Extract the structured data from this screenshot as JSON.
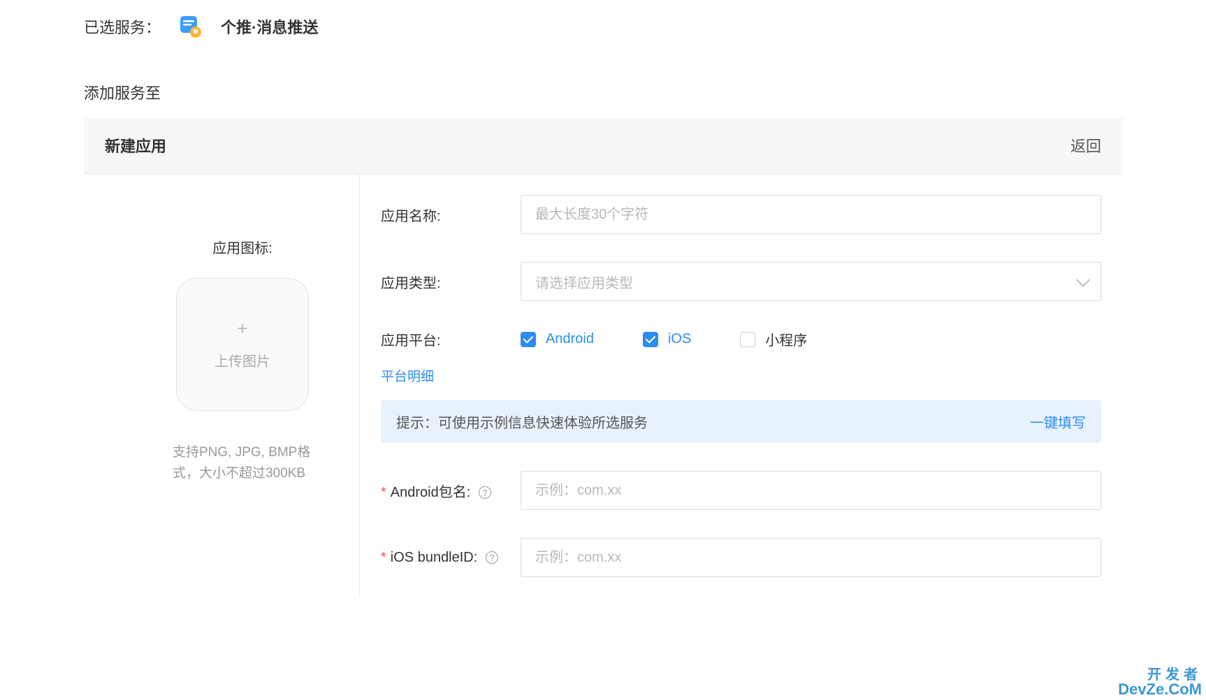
{
  "header": {
    "selected_service_label": "已选服务：",
    "service_name": "个推·消息推送",
    "add_service_to_label": "添加服务至"
  },
  "panel": {
    "title": "新建应用",
    "back_label": "返回"
  },
  "icon_upload": {
    "label": "应用图标:",
    "upload_text": "上传图片",
    "hint": "支持PNG, JPG, BMP格式，大小不超过300KB"
  },
  "form": {
    "app_name": {
      "label": "应用名称:",
      "placeholder": "最大长度30个字符",
      "value": ""
    },
    "app_type": {
      "label": "应用类型:",
      "placeholder": "请选择应用类型",
      "value": ""
    },
    "platform": {
      "label": "应用平台:",
      "detail_link": "平台明细",
      "options": [
        {
          "key": "android",
          "label": "Android",
          "checked": true
        },
        {
          "key": "ios",
          "label": "iOS",
          "checked": true
        },
        {
          "key": "miniprogram",
          "label": "小程序",
          "checked": false
        }
      ]
    },
    "hint_bar": {
      "prefix": "提示：",
      "text": "可使用示例信息快速体验所选服务",
      "action": "一键填写"
    },
    "android_pkg": {
      "label": "Android包名:",
      "placeholder": "示例：com.xx",
      "required": true
    },
    "ios_bundle": {
      "label": "iOS bundleID:",
      "placeholder": "示例：com.xx",
      "required": true
    }
  },
  "watermark": {
    "line1": "开发者",
    "line2": "DevZe.CoM"
  }
}
